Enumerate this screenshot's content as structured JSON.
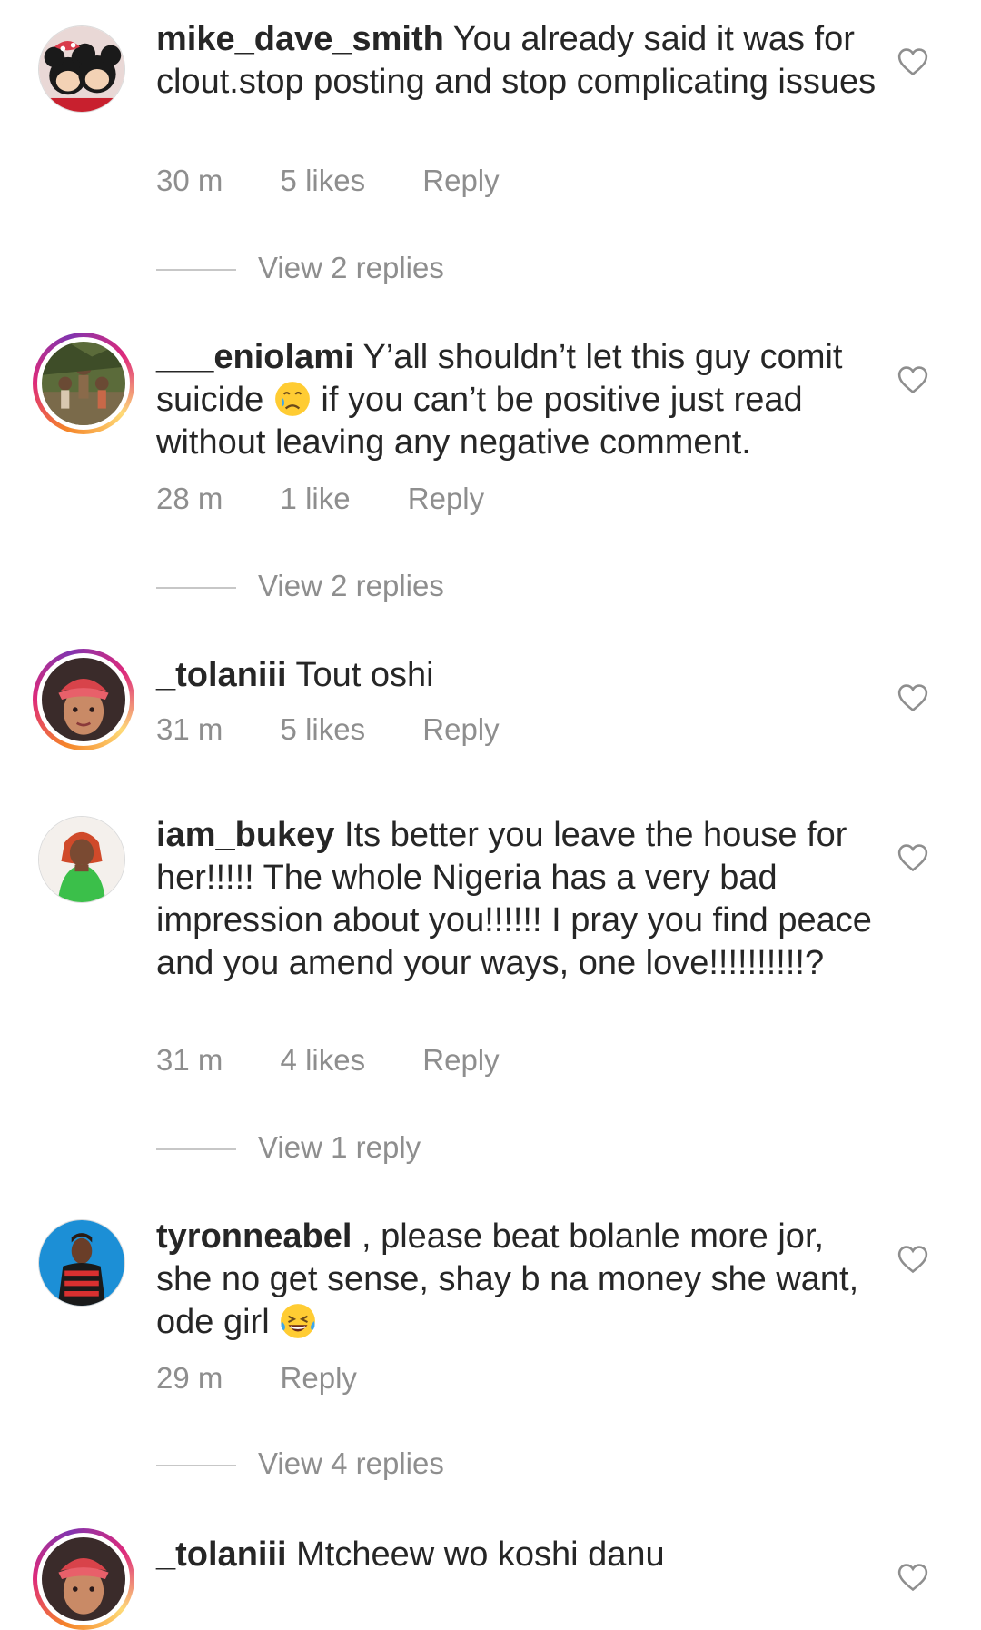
{
  "comments": [
    {
      "username": "mike_dave_smith",
      "text_before": "You already said it was for clout.stop posting and stop complicating issues",
      "text_after": "",
      "time": "30 m",
      "likes": "5 likes",
      "reply": "Reply",
      "view_replies": "View 2 replies",
      "avatar": "mickey-minnie-avatar",
      "story_ring": false
    },
    {
      "username": "___eniolami",
      "text_before": "Y’all shouldn’t let this guy comit suicide",
      "emoji": "crying-face-emoji",
      "text_after": "if you can’t be positive just read without leaving any negative comment.",
      "time": "28 m",
      "likes": "1 like",
      "reply": "Reply",
      "view_replies": "View 2 replies",
      "avatar": "kids-outdoor-avatar",
      "story_ring": true
    },
    {
      "username": "_tolaniii",
      "text_before": "Tout oshi",
      "text_after": "",
      "time": "31 m",
      "likes": "5 likes",
      "reply": "Reply",
      "view_replies": "",
      "avatar": "woman-headwrap-avatar",
      "story_ring": true
    },
    {
      "username": "iam_bukey",
      "text_before": "Its better you leave the house for her!!!!! The whole Nigeria has a very bad impression about you!!!!!! I pray you find peace and you amend your ways, one love!!!!!!!!!!?",
      "text_after": "",
      "time": "31 m",
      "likes": "4 likes",
      "reply": "Reply",
      "view_replies": "View 1 reply",
      "avatar": "woman-green-top-avatar",
      "story_ring": false
    },
    {
      "username": "tyronneabel",
      "text_before": ", please beat bolanle more jor, she no get sense, shay b na money she want,  ode girl",
      "emoji": "laughing-tears-emoji",
      "text_after": "",
      "time": "29 m",
      "likes": "",
      "reply": "Reply",
      "view_replies": "View 4 replies",
      "avatar": "man-blue-background-avatar",
      "story_ring": false
    },
    {
      "username": "_tolaniii",
      "text_before": "Mtcheew wo koshi danu",
      "text_after": "",
      "time": "",
      "likes": "",
      "reply": "",
      "view_replies": "",
      "avatar": "woman-headwrap-avatar",
      "story_ring": true
    }
  ],
  "icons": {
    "like": "heart-outline-icon"
  },
  "colors": {
    "text": "#262626",
    "secondary": "#8e8e8e",
    "divider": "#c7c7c7"
  }
}
